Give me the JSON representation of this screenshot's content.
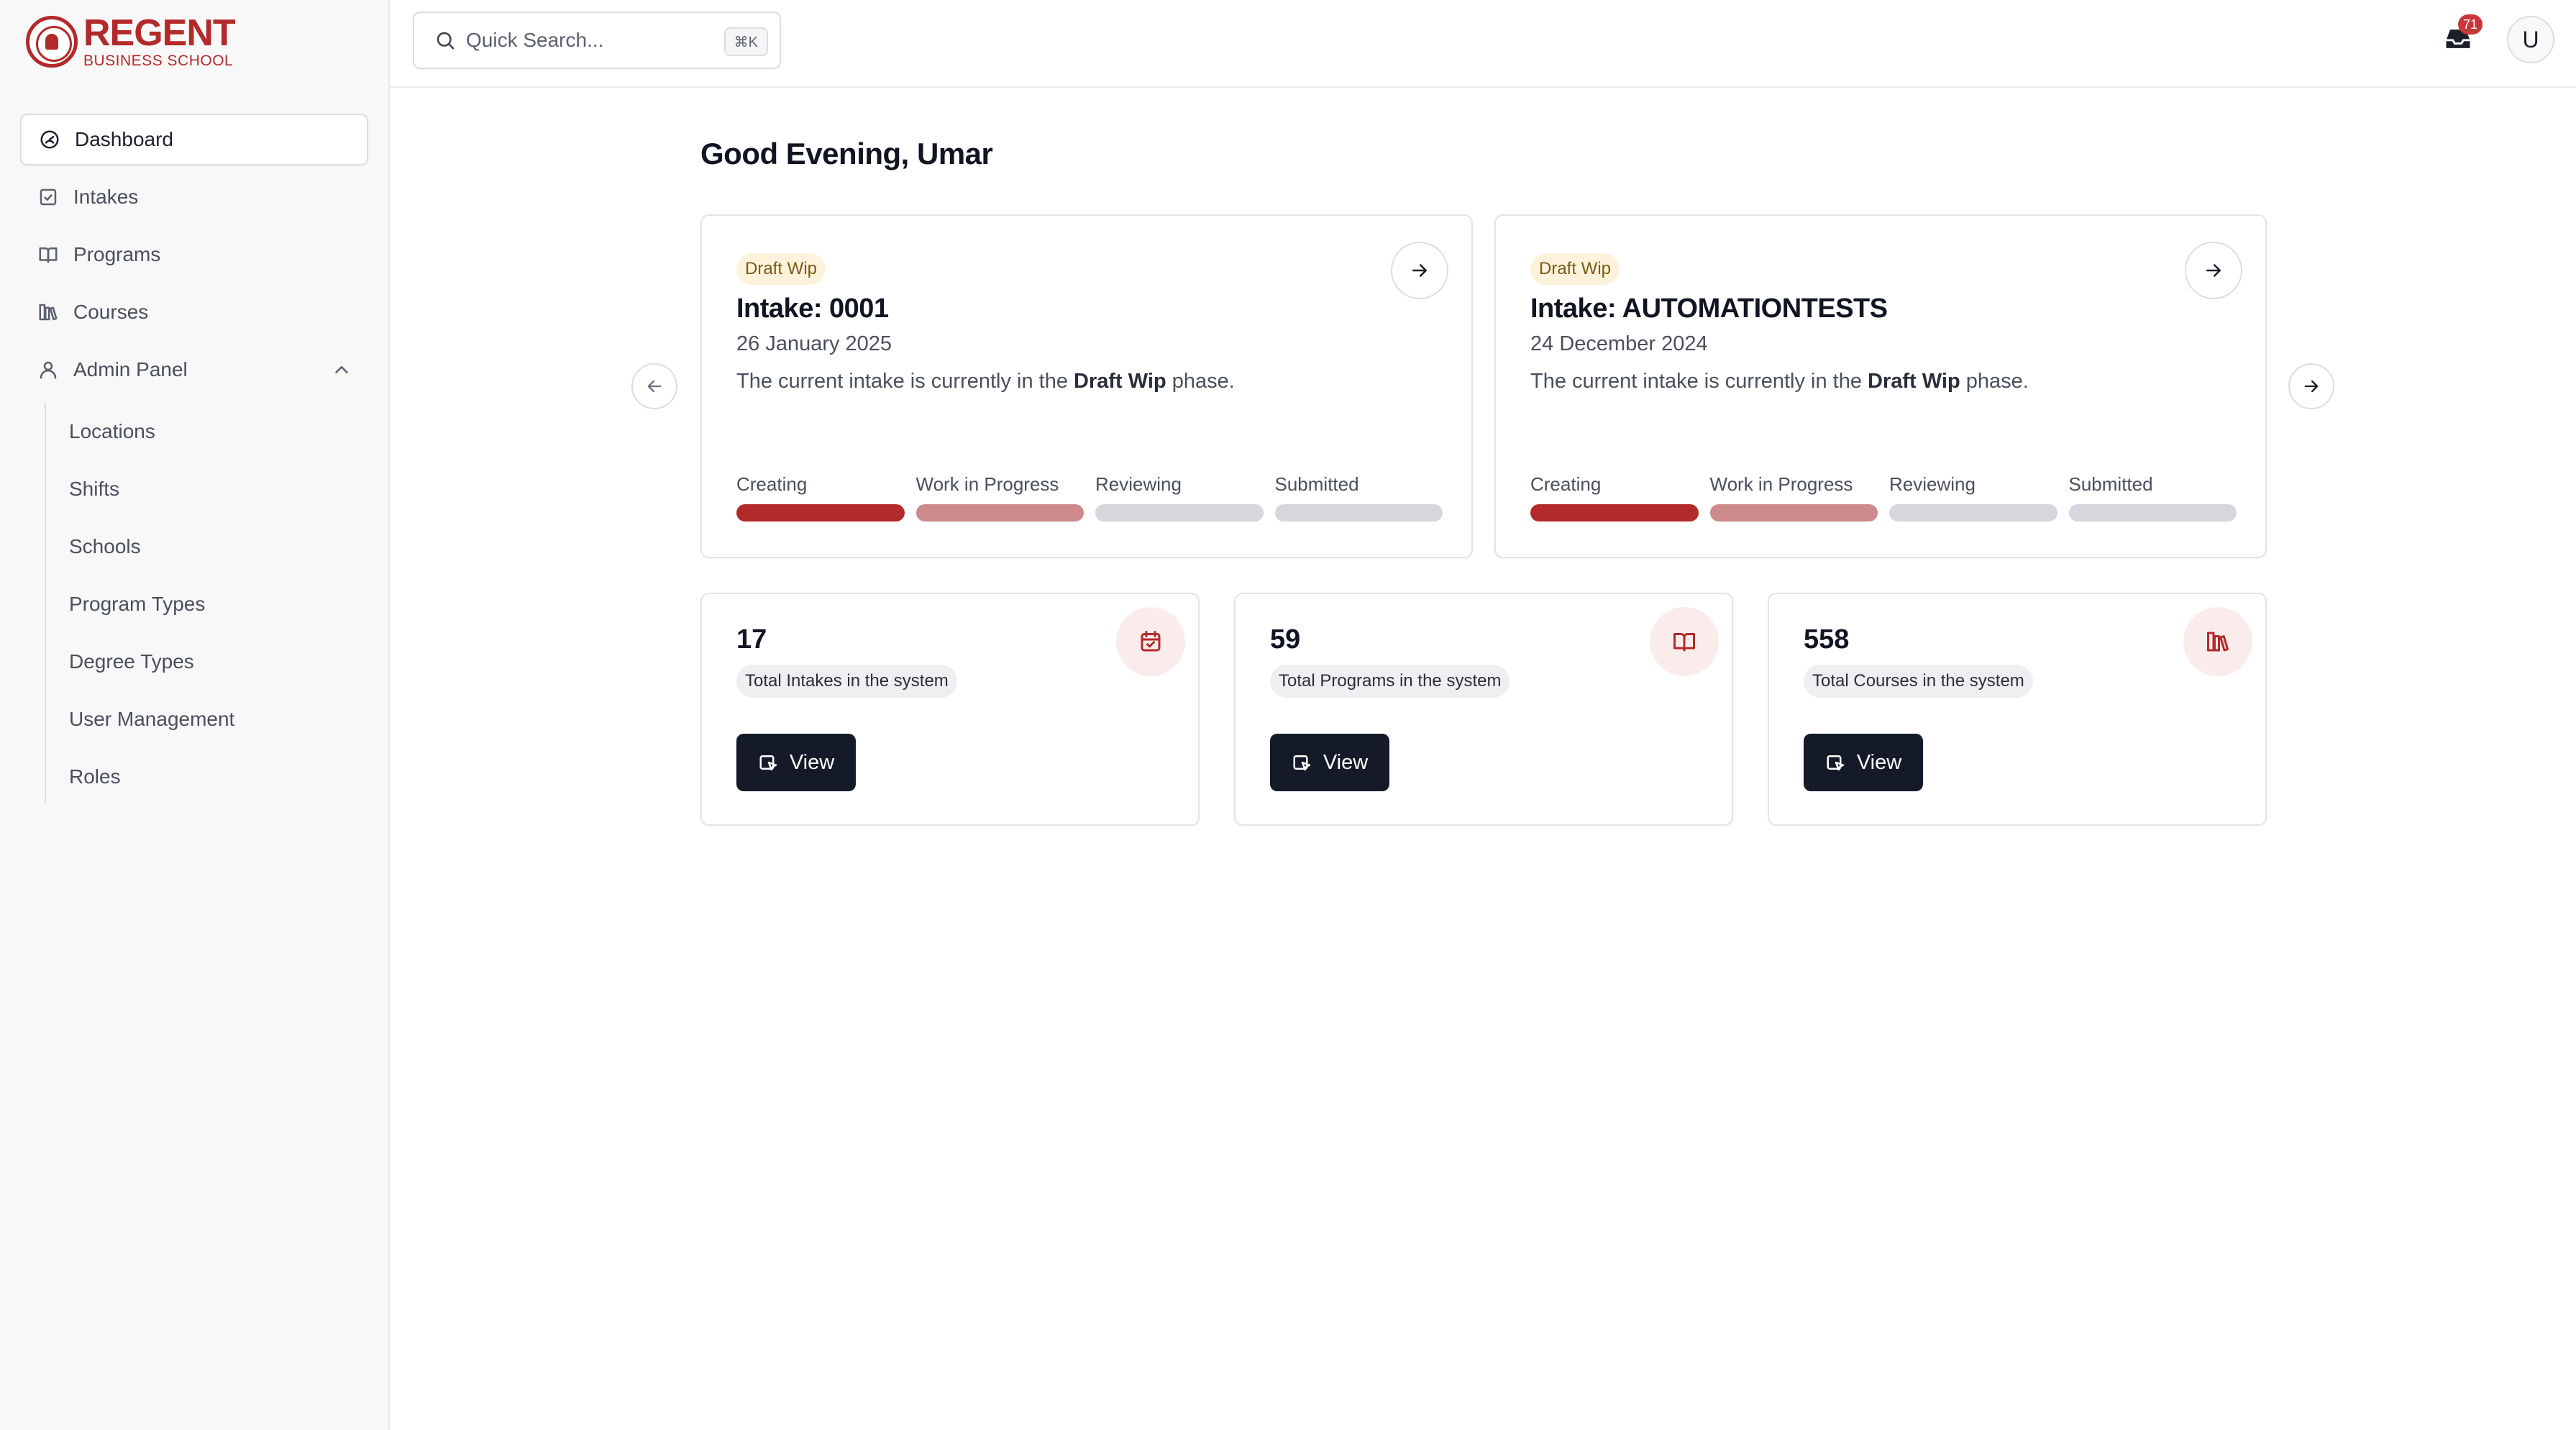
{
  "brand": {
    "name": "REGENT",
    "subtitle": "BUSINESS SCHOOL"
  },
  "sidebar": {
    "items": [
      {
        "label": "Dashboard",
        "icon": "dashboard-icon",
        "active": true
      },
      {
        "label": "Intakes",
        "icon": "calendar-check-icon"
      },
      {
        "label": "Programs",
        "icon": "book-open-icon"
      },
      {
        "label": "Courses",
        "icon": "library-icon"
      },
      {
        "label": "Admin Panel",
        "icon": "user-icon",
        "expanded": true
      }
    ],
    "admin_items": [
      "Locations",
      "Shifts",
      "Schools",
      "Program Types",
      "Degree Types",
      "User Management",
      "Roles"
    ]
  },
  "search": {
    "placeholder": "Quick Search...",
    "shortcut": "⌘K"
  },
  "notifications": {
    "count": "71"
  },
  "user": {
    "initial": "U"
  },
  "greeting": "Good Evening, Umar",
  "intakes": [
    {
      "status": "Draft Wip",
      "title": "Intake: 0001",
      "date": "26 January 2025",
      "desc_prefix": "The current intake is currently in the ",
      "desc_phase": "Draft Wip",
      "desc_suffix": " phase.",
      "stages": [
        "Creating",
        "Work in Progress",
        "Reviewing",
        "Submitted"
      ]
    },
    {
      "status": "Draft Wip",
      "title": "Intake: AUTOMATIONTESTS",
      "date": "24 December 2024",
      "desc_prefix": "The current intake is currently in the ",
      "desc_phase": "Draft Wip",
      "desc_suffix": " phase.",
      "stages": [
        "Creating",
        "Work in Progress",
        "Reviewing",
        "Submitted"
      ]
    }
  ],
  "stats": [
    {
      "value": "17",
      "label": "Total Intakes in the system",
      "icon": "calendar-check-icon",
      "button": "View"
    },
    {
      "value": "59",
      "label": "Total Programs in the system",
      "icon": "book-open-icon",
      "button": "View"
    },
    {
      "value": "558",
      "label": "Total Courses in the system",
      "icon": "library-icon",
      "button": "View"
    }
  ],
  "colors": {
    "brand": "#b32a2a",
    "stage_done": "#b32a2a",
    "stage_current": "#cc8a8c",
    "stage_pending": "#d6d7dc",
    "button": "#151a28"
  }
}
